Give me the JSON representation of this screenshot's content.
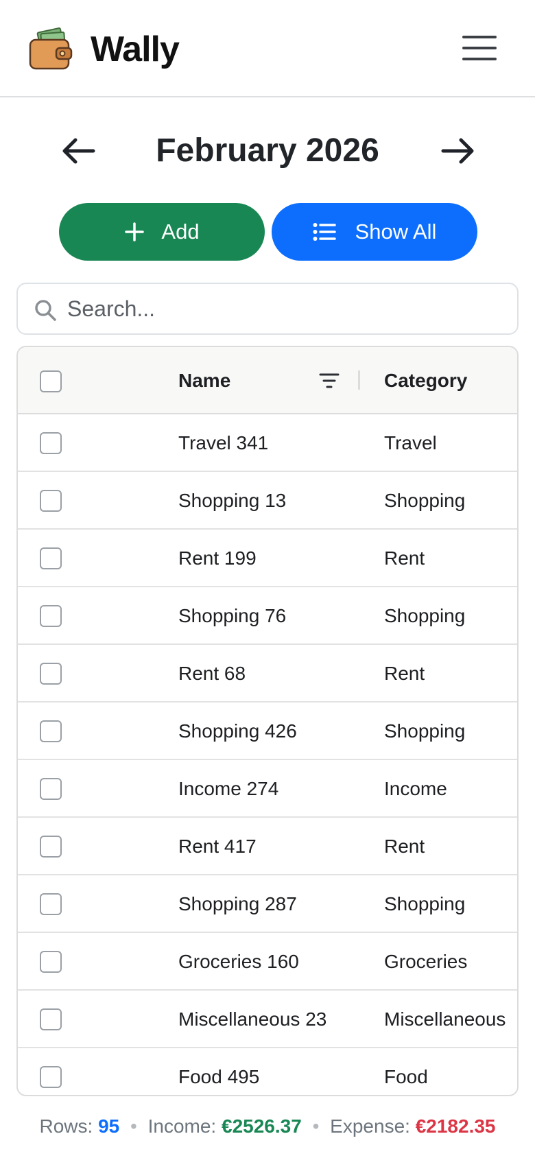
{
  "app": {
    "name": "Wally",
    "logo_icon": "wallet-icon",
    "menu_icon": "hamburger-menu-icon"
  },
  "month_nav": {
    "title": "February 2026",
    "prev_icon": "arrow-left-icon",
    "next_icon": "arrow-right-icon"
  },
  "actions": {
    "add_label": "Add",
    "add_icon": "plus-icon",
    "add_color": "#198754",
    "show_all_label": "Show All",
    "show_all_icon": "list-icon",
    "show_all_color": "#0d6efd"
  },
  "search": {
    "placeholder": "Search...",
    "value": ""
  },
  "table": {
    "columns": {
      "name": "Name",
      "category": "Category"
    },
    "rows": [
      {
        "name": "Travel 341",
        "category": "Travel"
      },
      {
        "name": "Shopping 13",
        "category": "Shopping"
      },
      {
        "name": "Rent 199",
        "category": "Rent"
      },
      {
        "name": "Shopping 76",
        "category": "Shopping"
      },
      {
        "name": "Rent 68",
        "category": "Rent"
      },
      {
        "name": "Shopping 426",
        "category": "Shopping"
      },
      {
        "name": "Income 274",
        "category": "Income"
      },
      {
        "name": "Rent 417",
        "category": "Rent"
      },
      {
        "name": "Shopping 287",
        "category": "Shopping"
      },
      {
        "name": "Groceries 160",
        "category": "Groceries"
      },
      {
        "name": "Miscellaneous 23",
        "category": "Miscellaneous"
      },
      {
        "name": "Food 495",
        "category": "Food"
      }
    ]
  },
  "summary": {
    "rows_label": "Rows:",
    "rows_value": "95",
    "income_label": "Income:",
    "income_value": "€2526.37",
    "expense_label": "Expense:",
    "expense_value": "€2182.35",
    "income_color": "#198754",
    "expense_color": "#dc3545"
  }
}
